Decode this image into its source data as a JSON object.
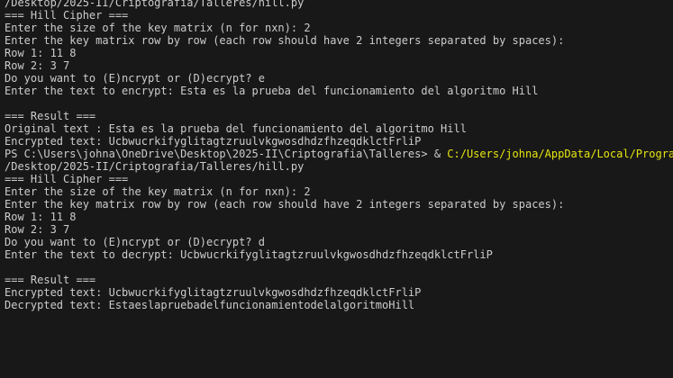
{
  "terminal": {
    "lines": [
      "/Desktop/2025-II/Criptografia/Talleres/hill.py",
      "=== Hill Cipher ===",
      "Enter the size of the key matrix (n for nxn): 2",
      "Enter the key matrix row by row (each row should have 2 integers separated by spaces):",
      "Row 1: 11 8",
      "Row 2: 3 7",
      "Do you want to (E)ncrypt or (D)ecrypt? e",
      "Enter the text to encrypt: Esta es la prueba del funcionamiento del algoritmo Hill",
      "",
      "=== Result ===",
      "Original text : Esta es la prueba del funcionamiento del algoritmo Hill",
      "Encrypted text: UcbwucrkifyglitagtzruulvkgwosdhdzfhzeqdklctFrliP",
      "",
      "/Desktop/2025-II/Criptografia/Talleres/hill.py",
      "=== Hill Cipher ===",
      "Enter the size of the key matrix (n for nxn): 2",
      "Enter the key matrix row by row (each row should have 2 integers separated by spaces):",
      "Row 1: 11 8",
      "Row 2: 3 7",
      "Do you want to (E)ncrypt or (D)ecrypt? d",
      "Enter the text to decrypt: UcbwucrkifyglitagtzruulvkgwosdhdzfhzeqdklctFrliP",
      "",
      "=== Result ===",
      "Encrypted text: UcbwucrkifyglitagtzruulvkgwosdhdzfhzeqdklctFrliP",
      "Decrypted text: EstaeslapruebadelfuncionamientodelalgoritmoHill"
    ],
    "prompt": "PS C:\\Users\\johna\\OneDrive\\Desktop\\2025-II\\Criptografia\\Talleres>",
    "prompt_operator": " &",
    "prompt_command": " C:/Users/johna/AppData/Local/Programs/",
    "colors": {
      "background": "#181818",
      "text": "#cccccc",
      "command_path": "#e5e510"
    }
  }
}
